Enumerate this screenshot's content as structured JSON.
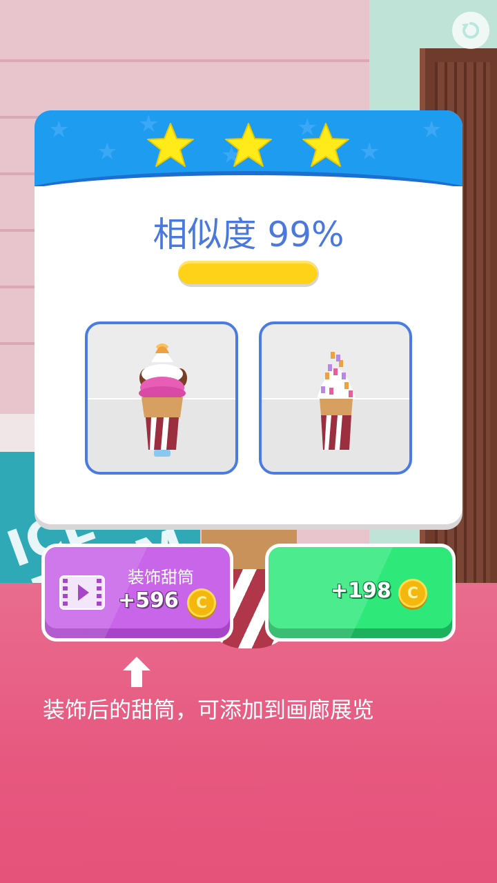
{
  "result": {
    "stars_earned": 3,
    "stars_total": 3,
    "similarity_text": "相似度 99%",
    "similarity_fraction": 0.99
  },
  "buttons": {
    "decorate": {
      "label": "装饰甜筒",
      "reward": "+596",
      "icon": "video-icon"
    },
    "collect": {
      "reward": "+198"
    },
    "coin_symbol": "C"
  },
  "hint": {
    "text": "装饰后的甜筒，可添加到画廊展览"
  },
  "colors": {
    "header_blue": "#1e9cf0",
    "star_yellow": "#ffeb1a",
    "text_blue": "#4a78dc",
    "progress_yellow": "#ffd21a",
    "decorate_purple": "#c865e9",
    "collect_green": "#2ee87a",
    "floor_pink": "#e7587f"
  }
}
